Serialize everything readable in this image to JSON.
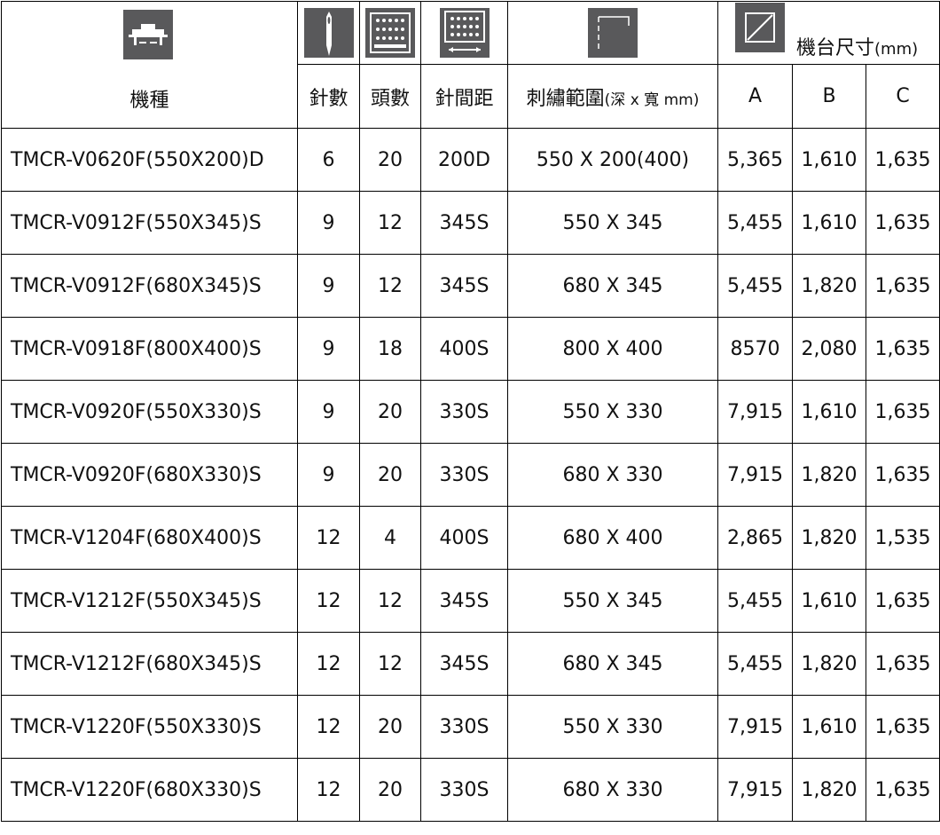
{
  "header": {
    "model": "機種",
    "needles": "針數",
    "heads": "頭數",
    "pitch": "針間距",
    "area_main": "刺繡範圍",
    "area_unit": "(深 x 寬 mm)",
    "dims_main": "機台尺寸",
    "dims_unit": "(mm)",
    "col_a": "A",
    "col_b": "B",
    "col_c": "C",
    "icons": [
      "machine-icon",
      "needle-icon",
      "heads-icon",
      "pitch-icon",
      "embroidery-area-icon",
      "dimension-icon"
    ]
  },
  "rows": [
    {
      "model": "TMCR-V0620F(550X200)D",
      "needles": "6",
      "heads": "20",
      "pitch": "200D",
      "area": "550 X 200(400)",
      "a": "5,365",
      "b": "1,610",
      "c": "1,635"
    },
    {
      "model": "TMCR-V0912F(550X345)S",
      "needles": "9",
      "heads": "12",
      "pitch": "345S",
      "area": "550 X 345",
      "a": "5,455",
      "b": "1,610",
      "c": "1,635"
    },
    {
      "model": "TMCR-V0912F(680X345)S",
      "needles": "9",
      "heads": "12",
      "pitch": "345S",
      "area": "680 X 345",
      "a": "5,455",
      "b": "1,820",
      "c": "1,635"
    },
    {
      "model": "TMCR-V0918F(800X400)S",
      "needles": "9",
      "heads": "18",
      "pitch": "400S",
      "area": "800 X 400",
      "a": "8570",
      "b": "2,080",
      "c": "1,635"
    },
    {
      "model": "TMCR-V0920F(550X330)S",
      "needles": "9",
      "heads": "20",
      "pitch": "330S",
      "area": "550 X 330",
      "a": "7,915",
      "b": "1,610",
      "c": "1,635"
    },
    {
      "model": "TMCR-V0920F(680X330)S",
      "needles": "9",
      "heads": "20",
      "pitch": "330S",
      "area": "680 X 330",
      "a": "7,915",
      "b": "1,820",
      "c": "1,635"
    },
    {
      "model": "TMCR-V1204F(680X400)S",
      "needles": "12",
      "heads": "4",
      "pitch": "400S",
      "area": "680 X 400",
      "a": "2,865",
      "b": "1,820",
      "c": "1,535"
    },
    {
      "model": "TMCR-V1212F(550X345)S",
      "needles": "12",
      "heads": "12",
      "pitch": "345S",
      "area": "550 X 345",
      "a": "5,455",
      "b": "1,610",
      "c": "1,635"
    },
    {
      "model": "TMCR-V1212F(680X345)S",
      "needles": "12",
      "heads": "12",
      "pitch": "345S",
      "area": "680 X 345",
      "a": "5,455",
      "b": "1,820",
      "c": "1,635"
    },
    {
      "model": "TMCR-V1220F(550X330)S",
      "needles": "12",
      "heads": "20",
      "pitch": "330S",
      "area": "550 X 330",
      "a": "7,915",
      "b": "1,610",
      "c": "1,635"
    },
    {
      "model": "TMCR-V1220F(680X330)S",
      "needles": "12",
      "heads": "20",
      "pitch": "330S",
      "area": "680 X 330",
      "a": "7,915",
      "b": "1,820",
      "c": "1,635"
    }
  ]
}
